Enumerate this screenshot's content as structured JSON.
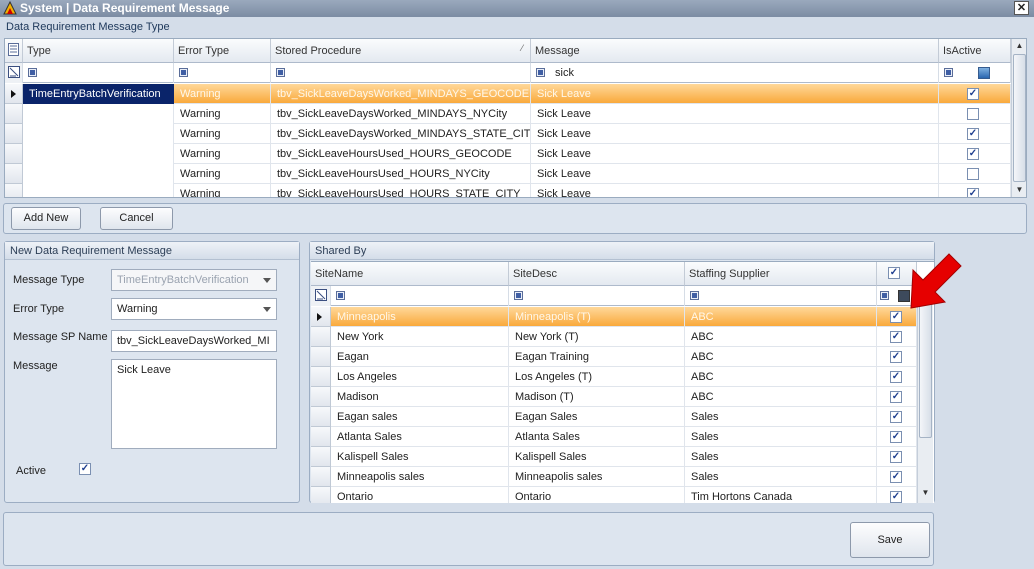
{
  "window": {
    "title": "System | Data Requirement Message",
    "close_label": "✕"
  },
  "top_grid": {
    "group_title": "Data Requirement Message Type",
    "columns": [
      "Type",
      "Error Type",
      "Stored Procedure",
      "Message",
      "IsActive"
    ],
    "filter_message": "sick",
    "selected_type": "TimeEntryBatchVerification",
    "rows": [
      {
        "error_type": "Warning",
        "stored_procedure": "tbv_SickLeaveDaysWorked_MINDAYS_GEOCODE",
        "message": "Sick Leave",
        "is_active": true
      },
      {
        "error_type": "Warning",
        "stored_procedure": "tbv_SickLeaveDaysWorked_MINDAYS_NYCity",
        "message": "Sick Leave",
        "is_active": false
      },
      {
        "error_type": "Warning",
        "stored_procedure": "tbv_SickLeaveDaysWorked_MINDAYS_STATE_CITY",
        "message": "Sick Leave",
        "is_active": true
      },
      {
        "error_type": "Warning",
        "stored_procedure": "tbv_SickLeaveHoursUsed_HOURS_GEOCODE",
        "message": "Sick Leave",
        "is_active": true
      },
      {
        "error_type": "Warning",
        "stored_procedure": "tbv_SickLeaveHoursUsed_HOURS_NYCity",
        "message": "Sick Leave",
        "is_active": false
      },
      {
        "error_type": "Warning",
        "stored_procedure": "tbv_SickLeaveHoursUsed_HOURS_STATE_CITY",
        "message": "Sick Leave",
        "is_active": true
      }
    ]
  },
  "actions": {
    "add_new": "Add New",
    "cancel": "Cancel",
    "save": "Save"
  },
  "form": {
    "title": "New Data Requirement Message",
    "message_type_label": "Message Type",
    "message_type_value": "TimeEntryBatchVerification",
    "error_type_label": "Error Type",
    "error_type_value": "Warning",
    "sp_name_label": "Message SP Name",
    "sp_name_value": "tbv_SickLeaveDaysWorked_MI",
    "message_label": "Message",
    "message_value": "Sick Leave",
    "active_label": "Active",
    "active": true
  },
  "shared_by": {
    "title": "Shared By",
    "columns": [
      "SiteName",
      "SiteDesc",
      "Staffing Supplier"
    ],
    "rows": [
      {
        "site_name": "Minneapolis",
        "site_desc": "Minneapolis (T)",
        "supplier": "ABC",
        "checked": true
      },
      {
        "site_name": "New York",
        "site_desc": "New York (T)",
        "supplier": "ABC",
        "checked": true
      },
      {
        "site_name": "Eagan",
        "site_desc": "Eagan Training",
        "supplier": "ABC",
        "checked": true
      },
      {
        "site_name": "Los Angeles",
        "site_desc": "Los Angeles (T)",
        "supplier": "ABC",
        "checked": true
      },
      {
        "site_name": "Madison",
        "site_desc": "Madison (T)",
        "supplier": "ABC",
        "checked": true
      },
      {
        "site_name": "Eagan sales",
        "site_desc": "Eagan Sales",
        "supplier": "Sales",
        "checked": true
      },
      {
        "site_name": "Atlanta Sales",
        "site_desc": "Atlanta Sales",
        "supplier": "Sales",
        "checked": true
      },
      {
        "site_name": "Kalispell Sales",
        "site_desc": "Kalispell Sales",
        "supplier": "Sales",
        "checked": true
      },
      {
        "site_name": "Minneapolis sales",
        "site_desc": "Minneapolis sales",
        "supplier": "Sales",
        "checked": true
      },
      {
        "site_name": "Ontario",
        "site_desc": "Ontario",
        "supplier": "Tim Hortons Canada",
        "checked": true
      }
    ]
  },
  "colors": {
    "selection": "#f9a93c",
    "accent_navy": "#0a246a",
    "arrow": "#e60000"
  }
}
